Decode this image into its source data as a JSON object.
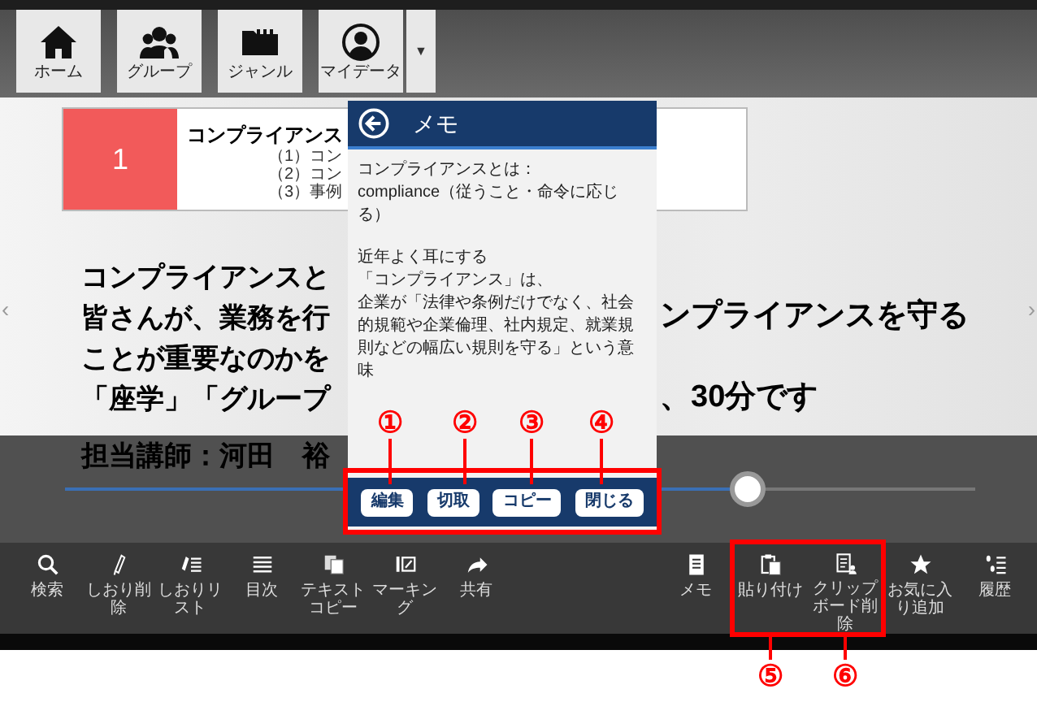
{
  "nav_buttons": [
    {
      "label": "ホーム"
    },
    {
      "label": "グループ"
    },
    {
      "label": "ジャンル"
    },
    {
      "label": "マイデータ"
    }
  ],
  "nav_dropdown": "▼",
  "slide": {
    "number": "1",
    "title": "コンプライアンス",
    "items": [
      "（1）コン",
      "（2）コン",
      "（3）事例"
    ],
    "lines": [
      {
        "left": "コンプライアンスと"
      },
      {
        "left": "皆さんが、業務を行",
        "right": "ンプライアンスを守る"
      },
      {
        "left": "ことが重要なのかを"
      },
      {
        "left": "「座学」「グループ",
        "right": "、30分です"
      }
    ],
    "lecturer": "担当講師：河田　裕",
    "prev": "‹",
    "next": "›"
  },
  "memo": {
    "title": "メモ",
    "paragraphs": [
      [
        "コンプライアンスとは：",
        "compliance（従うこと・命令に応じる）"
      ],
      [
        "近年よく耳にする",
        "「コンプライアンス」は、",
        "企業が「法律や条例だけでなく、社会的規範や企業倫理、社内規定、就業規則などの幅広い規則を守る」という意味"
      ]
    ],
    "buttons": [
      "編集",
      "切取",
      "コピー",
      "閉じる"
    ]
  },
  "slider": {
    "level": 0.75
  },
  "toolbar_left": [
    {
      "label": "検索"
    },
    {
      "label": "しおり削除"
    },
    {
      "label": "しおりリスト"
    },
    {
      "label": "目次"
    },
    {
      "label": "テキストコピー"
    },
    {
      "label": "マーキング"
    },
    {
      "label": "共有"
    }
  ],
  "toolbar_right": [
    {
      "label": "メモ"
    },
    {
      "label": "貼り付け"
    },
    {
      "label": "クリップボード削除"
    },
    {
      "label": "お気に入り追加"
    },
    {
      "label": "履歴"
    }
  ],
  "annotations": {
    "memo_buttons": [
      "①",
      "②",
      "③",
      "④"
    ],
    "toolbar": [
      "⑤",
      "⑥"
    ]
  }
}
